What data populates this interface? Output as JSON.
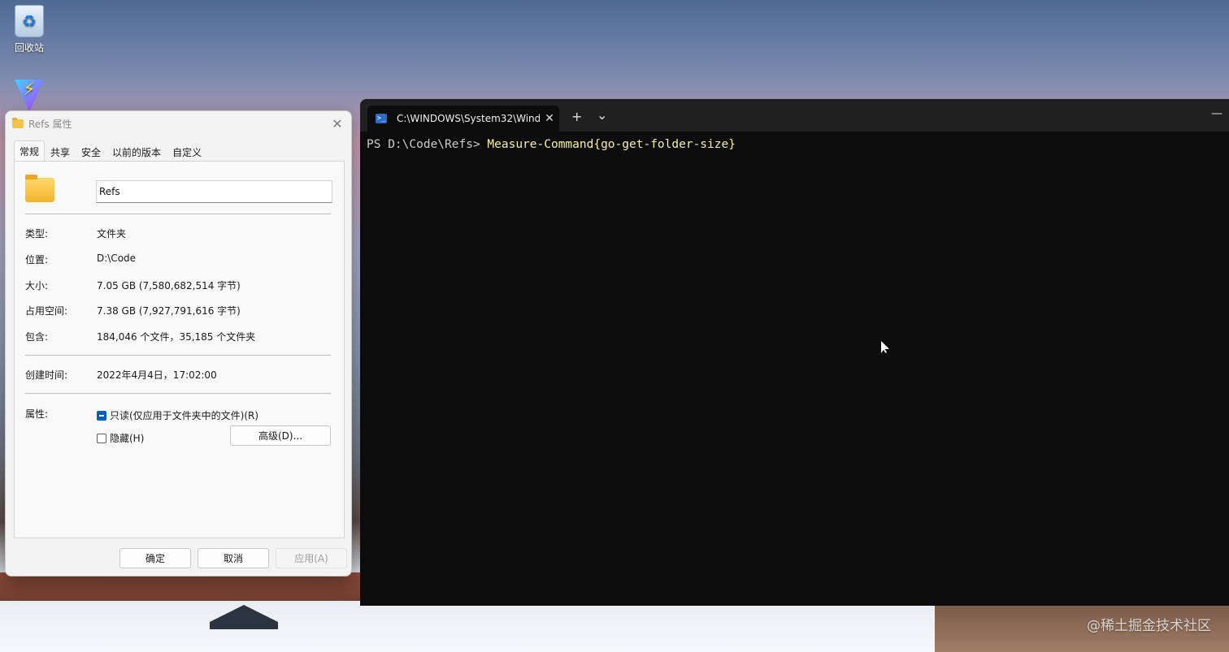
{
  "desktop": {
    "icons": [
      {
        "label": "回收站",
        "icon": "recycle-bin-icon"
      },
      {
        "label": "",
        "icon": "vite-icon"
      }
    ],
    "watermark": "@稀土掘金技术社区"
  },
  "properties_dialog": {
    "title": "Refs 属性",
    "tabs": [
      "常规",
      "共享",
      "安全",
      "以前的版本",
      "自定义"
    ],
    "active_tab": "常规",
    "name_value": "Refs",
    "rows": [
      {
        "label": "类型:",
        "value": "文件夹"
      },
      {
        "label": "位置:",
        "value": "D:\\Code"
      },
      {
        "label": "大小:",
        "value": "7.05 GB (7,580,682,514 字节)"
      },
      {
        "label": "占用空间:",
        "value": "7.38 GB (7,927,791,616 字节)"
      },
      {
        "label": "包含:",
        "value": "184,046 个文件，35,185 个文件夹"
      }
    ],
    "created_label": "创建时间:",
    "created_value": "2022年4月4日，17:02:00",
    "attributes_label": "属性:",
    "readonly_label": "只读(仅应用于文件夹中的文件)(R)",
    "readonly_state": "indeterminate",
    "hidden_label": "隐藏(H)",
    "hidden_state": "unchecked",
    "advanced_button": "高级(D)...",
    "ok_button": "确定",
    "cancel_button": "取消",
    "apply_button": "应用(A)"
  },
  "terminal": {
    "tab_title": "C:\\WINDOWS\\System32\\Wind",
    "new_tab_glyph": "+",
    "dropdown_glyph": "⌄",
    "minimize_glyph": "—",
    "prompt": "PS D:\\Code\\Refs> ",
    "command": "Measure-Command{go-get-folder-size}",
    "colors": {
      "background": "#0c0c0c",
      "command": "#f9f1a5",
      "prompt": "#cccccc"
    }
  }
}
